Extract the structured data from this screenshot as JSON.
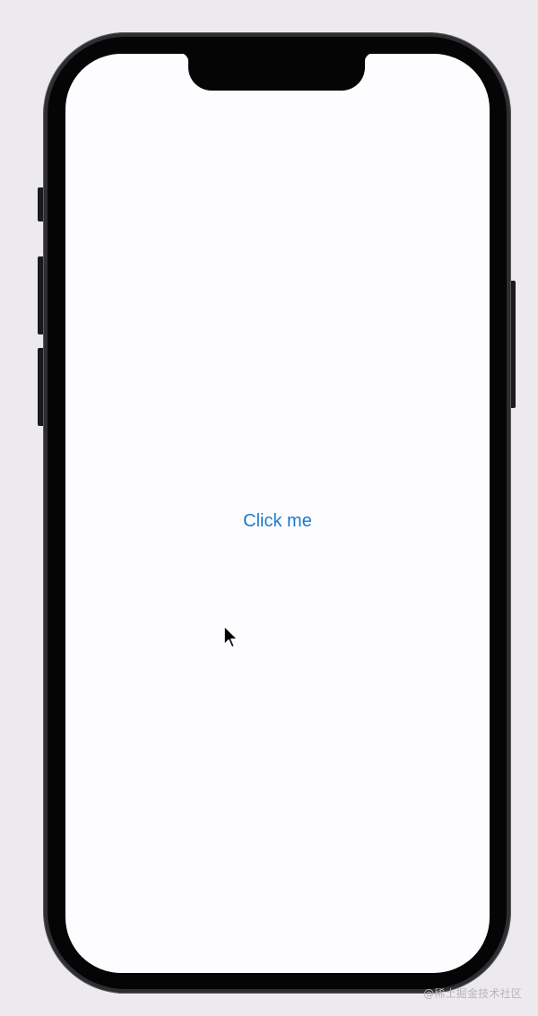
{
  "screen": {
    "button_label": "Click me"
  },
  "watermark": {
    "text": "@稀土掘金技术社区"
  },
  "colors": {
    "background": "#eceaec",
    "screen": "#fdfcfe",
    "accent": "#1a7ad0",
    "frame": "#050505"
  },
  "icons": {
    "cursor": "arrow-cursor-icon"
  }
}
